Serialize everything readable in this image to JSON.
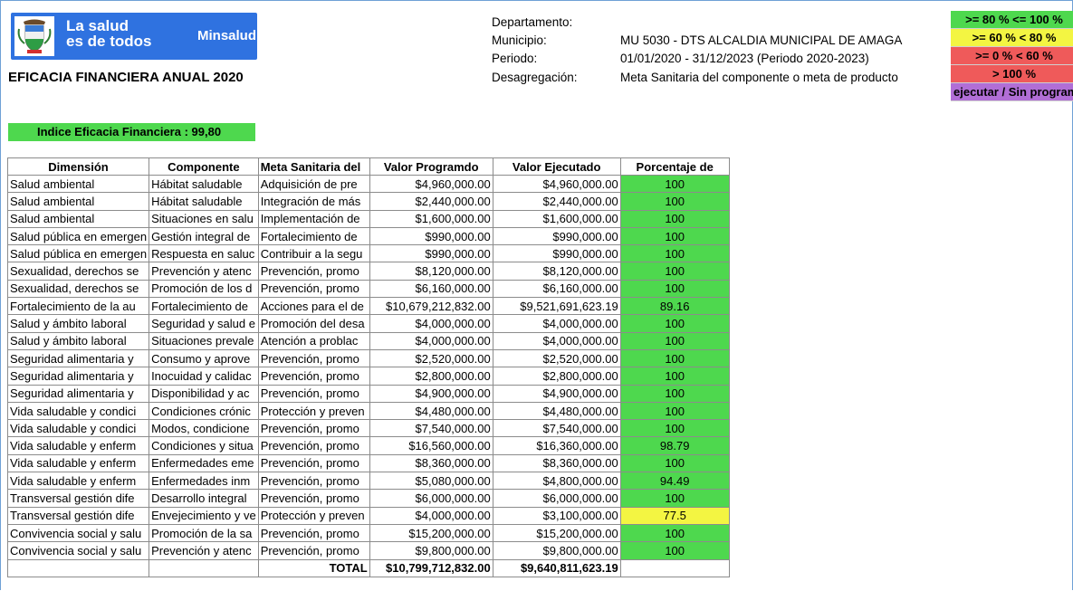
{
  "header": {
    "brand_line1": "La salud",
    "brand_line2": "es de todos",
    "brand_name": "Minsalud",
    "title": "EFICACIA FINANCIERA ANUAL 2020"
  },
  "meta": {
    "departamento_label": "Departamento:",
    "departamento_value": "",
    "municipio_label": "Municipio:",
    "municipio_value": "MU 5030 - DTS ALCALDIA MUNICIPAL DE AMAGA",
    "periodo_label": "Periodo:",
    "periodo_value": "01/01/2020 - 31/12/2023  (Periodo 2020-2023)",
    "desagregacion_label": "Desagregación:",
    "desagregacion_value": "Meta Sanitaria del componente o meta de producto"
  },
  "legend": [
    {
      "label": ">= 80 % <= 100 %",
      "color": "#4ed84e"
    },
    {
      "label": ">= 60 % < 80 %",
      "color": "#f3f542"
    },
    {
      "label": ">= 0 % < 60 %",
      "color": "#ef5a5a"
    },
    {
      "label": "> 100 %",
      "color": "#ef5a5a"
    },
    {
      "label": "ejecutar / Sin program",
      "color": "#b16ed6"
    }
  ],
  "index": {
    "label": "Indice Eficacia Financiera : 99,80"
  },
  "table": {
    "headers": [
      "Dimensión",
      "Componente",
      "Meta Sanitaria del",
      "Valor Programdo",
      "Valor Ejecutado",
      "Porcentaje de"
    ],
    "rows": [
      [
        "Salud ambiental",
        "Hábitat saludable",
        "Adquisición de pre",
        "$4,960,000.00",
        "$4,960,000.00",
        "100"
      ],
      [
        "Salud ambiental",
        "Hábitat saludable",
        "Integración de más",
        "$2,440,000.00",
        "$2,440,000.00",
        "100"
      ],
      [
        "Salud ambiental",
        "Situaciones en salu",
        "Implementación de",
        "$1,600,000.00",
        "$1,600,000.00",
        "100"
      ],
      [
        "Salud pública en emergen",
        "Gestión integral de",
        "Fortalecimiento de",
        "$990,000.00",
        "$990,000.00",
        "100"
      ],
      [
        "Salud pública en emergen",
        "Respuesta en saluc",
        "Contribuir a la segu",
        "$990,000.00",
        "$990,000.00",
        "100"
      ],
      [
        "Sexualidad, derechos se",
        "Prevención y atenc",
        "Prevención, promo",
        "$8,120,000.00",
        "$8,120,000.00",
        "100"
      ],
      [
        "Sexualidad, derechos se",
        "Promoción de los d",
        "Prevención, promo",
        "$6,160,000.00",
        "$6,160,000.00",
        "100"
      ],
      [
        "Fortalecimiento de la au",
        "Fortalecimiento de",
        "Acciones para el de",
        "$10,679,212,832.00",
        "$9,521,691,623.19",
        "89.16"
      ],
      [
        "Salud y ámbito laboral",
        "Seguridad y salud e",
        "Promoción del desa",
        "$4,000,000.00",
        "$4,000,000.00",
        "100"
      ],
      [
        "Salud y ámbito laboral",
        "Situaciones prevale",
        "Atención a problac",
        "$4,000,000.00",
        "$4,000,000.00",
        "100"
      ],
      [
        "Seguridad alimentaria y",
        "Consumo y aprove",
        "Prevención, promo",
        "$2,520,000.00",
        "$2,520,000.00",
        "100"
      ],
      [
        "Seguridad alimentaria y",
        "Inocuidad y calidac",
        "Prevención, promo",
        "$2,800,000.00",
        "$2,800,000.00",
        "100"
      ],
      [
        "Seguridad alimentaria y",
        "Disponibilidad y ac",
        "Prevención, promo",
        "$4,900,000.00",
        "$4,900,000.00",
        "100"
      ],
      [
        "Vida saludable y condici",
        "Condiciones crónic",
        "Protección y preven",
        "$4,480,000.00",
        "$4,480,000.00",
        "100"
      ],
      [
        "Vida saludable y condici",
        "Modos, condicione",
        "Prevención, promo",
        "$7,540,000.00",
        "$7,540,000.00",
        "100"
      ],
      [
        "Vida saludable y enferm",
        "Condiciones y situa",
        "Prevención, promo",
        "$16,560,000.00",
        "$16,360,000.00",
        "98.79"
      ],
      [
        "Vida saludable y enferm",
        "Enfermedades eme",
        "Prevención, promo",
        "$8,360,000.00",
        "$8,360,000.00",
        "100"
      ],
      [
        "Vida saludable y enferm",
        "Enfermedades inm",
        "Prevención, promo",
        "$5,080,000.00",
        "$4,800,000.00",
        "94.49"
      ],
      [
        "Transversal gestión dife",
        "Desarrollo integral",
        "Prevención, promo",
        "$6,000,000.00",
        "$6,000,000.00",
        "100"
      ],
      [
        "Transversal gestión dife",
        "Envejecimiento y ve",
        "Protección y preven",
        "$4,000,000.00",
        "$3,100,000.00",
        "77.5"
      ],
      [
        "Convivencia social y salu",
        "Promoción de la sa",
        "Prevención, promo",
        "$15,200,000.00",
        "$15,200,000.00",
        "100"
      ],
      [
        "Convivencia social y salu",
        "Prevención y atenc",
        "Prevención, promo",
        "$9,800,000.00",
        "$9,800,000.00",
        "100"
      ]
    ],
    "row_colors": [
      "#4ed84e",
      "#4ed84e",
      "#4ed84e",
      "#4ed84e",
      "#4ed84e",
      "#4ed84e",
      "#4ed84e",
      "#4ed84e",
      "#4ed84e",
      "#4ed84e",
      "#4ed84e",
      "#4ed84e",
      "#4ed84e",
      "#4ed84e",
      "#4ed84e",
      "#4ed84e",
      "#4ed84e",
      "#4ed84e",
      "#4ed84e",
      "#f3f542",
      "#4ed84e",
      "#4ed84e"
    ],
    "total_label": "TOTAL",
    "total_programado": "$10,799,712,832.00",
    "total_ejecutado": "$9,640,811,623.19"
  }
}
